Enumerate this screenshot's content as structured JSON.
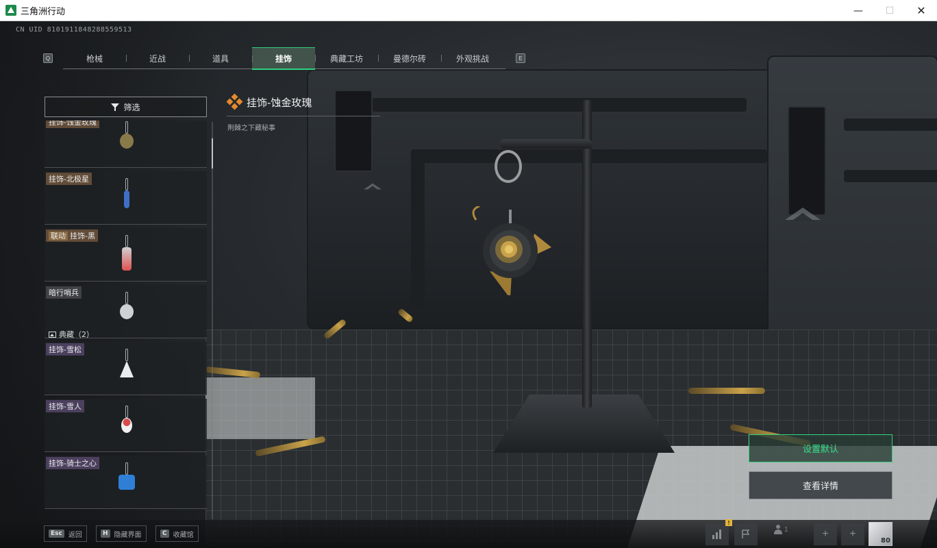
{
  "window": {
    "title": "三角洲行动",
    "minimize": "—",
    "maximize": "☐",
    "close": "✕"
  },
  "uid": "CN UID 8101911848288559513",
  "nav": {
    "left_key": "Q",
    "right_key": "E",
    "tabs": [
      "枪械",
      "近战",
      "道具",
      "挂饰",
      "典藏工坊",
      "曼德尔砖",
      "外观挑战"
    ],
    "active_tab": "挂饰"
  },
  "filter": {
    "label": "筛选"
  },
  "list": {
    "items": [
      {
        "label": "挂饰-蚀金玫瑰",
        "style": "brown",
        "collab": "",
        "charm_color": "#8a7a4a"
      },
      {
        "label": "挂饰-北极星",
        "style": "brown",
        "collab": "",
        "charm_color": "#3f6fc4"
      },
      {
        "label": "挂饰-黑",
        "style": "brown",
        "collab": "联动",
        "charm_color": "#d0d0d0"
      },
      {
        "label": "暗行哨兵",
        "style": "gray",
        "collab": "",
        "charm_color": "#cfd2d4"
      },
      {
        "label": "挂饰-雪松",
        "style": "purple",
        "collab": "",
        "charm_color": "#e8ecee"
      },
      {
        "label": "挂饰-雪人",
        "style": "purple",
        "collab": "",
        "charm_color": "#d94a4a"
      },
      {
        "label": "挂饰-骑士之心",
        "style": "purple",
        "collab": "",
        "charm_color": "#2f7fd6"
      }
    ],
    "group_label": "典藏（2）"
  },
  "detail": {
    "title": "挂饰-蚀金玫瑰",
    "description": "荆棘之下藏秘事"
  },
  "actions": {
    "set_default": "设置默认",
    "view_details": "查看详情"
  },
  "bottom_hints": [
    {
      "key": "Esc",
      "label": "返回"
    },
    {
      "key": "H",
      "label": "隐藏界面"
    },
    {
      "key": "C",
      "label": "收藏馆"
    }
  ],
  "tray": {
    "warning": "!",
    "friends_count": "1",
    "avatar_level": "80",
    "add": "+"
  },
  "colors": {
    "accent": "#2fd17e",
    "brown_tag": "#6e553c",
    "purple_tag": "#554669",
    "orange_icon": "#e58a2c"
  }
}
